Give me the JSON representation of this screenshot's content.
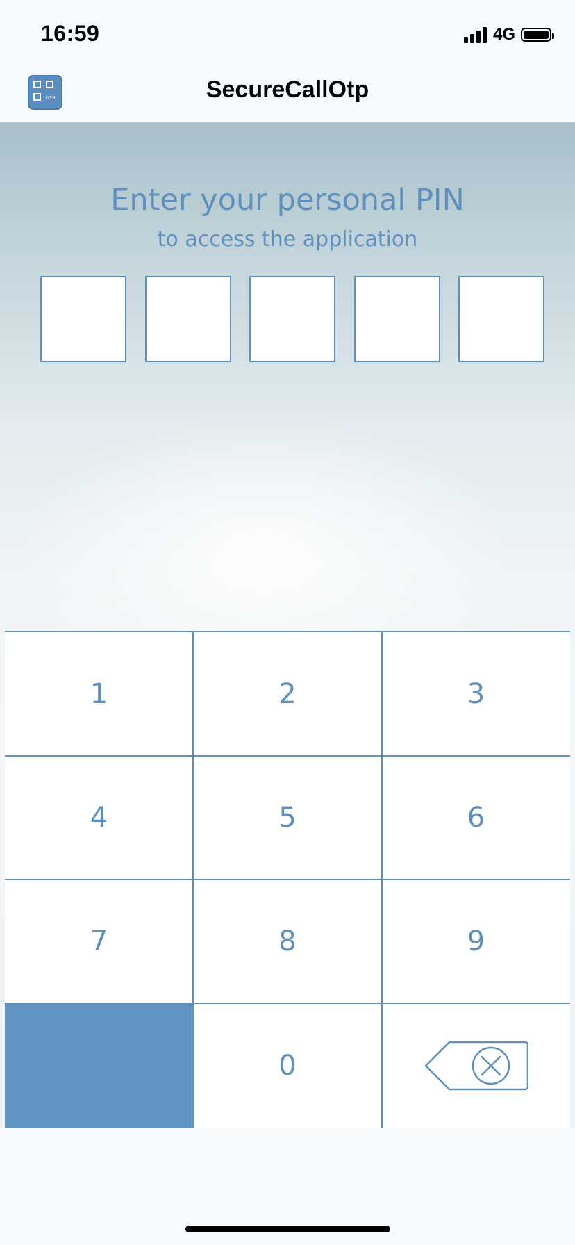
{
  "status_bar": {
    "time": "16:59",
    "network": "4G",
    "signal_bars": 4,
    "battery_level": 1.0
  },
  "nav": {
    "title": "SecureCallOtp",
    "app_icon": "qr-otp-icon",
    "app_icon_text": "OTP"
  },
  "prompt": {
    "title": "Enter your personal PIN",
    "subtitle": "to access the application"
  },
  "pin": {
    "length": 5,
    "digits": [
      "",
      "",
      "",
      "",
      ""
    ]
  },
  "keypad": {
    "keys": [
      "1",
      "2",
      "3",
      "4",
      "5",
      "6",
      "7",
      "8",
      "9",
      "",
      "0",
      ""
    ],
    "backspace_icon": "backspace-icon"
  },
  "colors": {
    "accent": "#5f8fbd",
    "accent_fill": "#5f93c2",
    "background": "#f4f7f8"
  }
}
